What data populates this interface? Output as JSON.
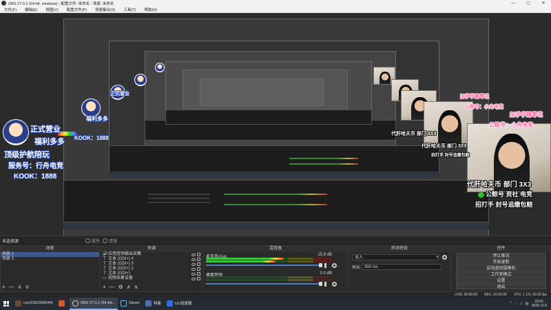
{
  "window": {
    "title": "OBS 27.0.1 (64-bit, windows) - 配置文件: 未命名 - 场景: 未命名",
    "buttons": [
      "—",
      "▢",
      "✕"
    ]
  },
  "menu": [
    "文件(F)",
    "编辑(E)",
    "视图(V)",
    "配置文件(P)",
    "场景集合(S)",
    "工具(T)",
    "帮助(H)"
  ],
  "preview": {
    "overlay_left": [
      "正式营业",
      "福利多多",
      "顶级护航陪玩",
      "服务号：行舟电竞",
      "KOOK：1888"
    ],
    "overlay_right": [
      "代肝哈夫币 部门 3X3",
      "公粽号 资社 电竞",
      "招打手 封号追缴包赔"
    ],
    "overlay_pink": [
      "加手手赚零花",
      "公粽号：小舟电竞"
    ]
  },
  "scenebar": {
    "label": "未选择源",
    "props": "属性",
    "filters": "滤镜"
  },
  "scenes": {
    "title": "场景",
    "items": [
      "场景 2",
      "场景 3"
    ],
    "tools": [
      "+",
      "—",
      "∧",
      "∨"
    ]
  },
  "sources": {
    "title": "来源",
    "items": [
      {
        "icon": "🔊",
        "name": "应用音频输出采集"
      },
      {
        "icon": "T",
        "name": "文本 (GDI+) 4"
      },
      {
        "icon": "T",
        "name": "文本 (GDI+) 3"
      },
      {
        "icon": "T",
        "name": "文本 (GDI+) 2"
      },
      {
        "icon": "T",
        "name": "文本 (GDI+)"
      },
      {
        "icon": "▭",
        "name": "视频采集设备"
      }
    ],
    "tools": [
      "+",
      "—",
      "⚙",
      "∧",
      "∨"
    ]
  },
  "mixer": {
    "title": "混音器",
    "tracks": [
      {
        "name": "麦克风/Aux",
        "db": "15.9 dB",
        "level": 0.62,
        "level2": 0.55
      },
      {
        "name": "桌面音频",
        "db": "0.0 dB",
        "level": 0.0,
        "level2": 0.0
      }
    ]
  },
  "transitions": {
    "title": "转场特效",
    "selected": "淡入",
    "duration_label": "时长",
    "duration": "300 ms",
    "add": "+"
  },
  "controls": {
    "title": "控件",
    "buttons": [
      "停止推流",
      "开始录制",
      "启动虚拟摄像机",
      "工作室模式",
      "设置",
      "退出"
    ]
  },
  "stats": {
    "live": "LIVE: 00:00:00",
    "rec": "REC: 00:00:00",
    "cpu": "CPU: 1.1%, 60.00 fps"
  },
  "taskbar": {
    "items": [
      {
        "label": "cxn(2362396644)",
        "color": "#6a4a32"
      },
      {
        "label": "",
        "color": "#d35a2a"
      },
      {
        "label": "OBS 27.0.1 (64-bit...",
        "color": "#3a3a3a"
      },
      {
        "label": "Steam",
        "color": "#1b2838"
      },
      {
        "label": "特曼",
        "color": "#4a6fb5"
      },
      {
        "label": "UU加速器",
        "color": "#2f6fd6"
      }
    ],
    "tray": {
      "lang": "中",
      "time": "22:01",
      "date": "2025.12.6"
    }
  }
}
